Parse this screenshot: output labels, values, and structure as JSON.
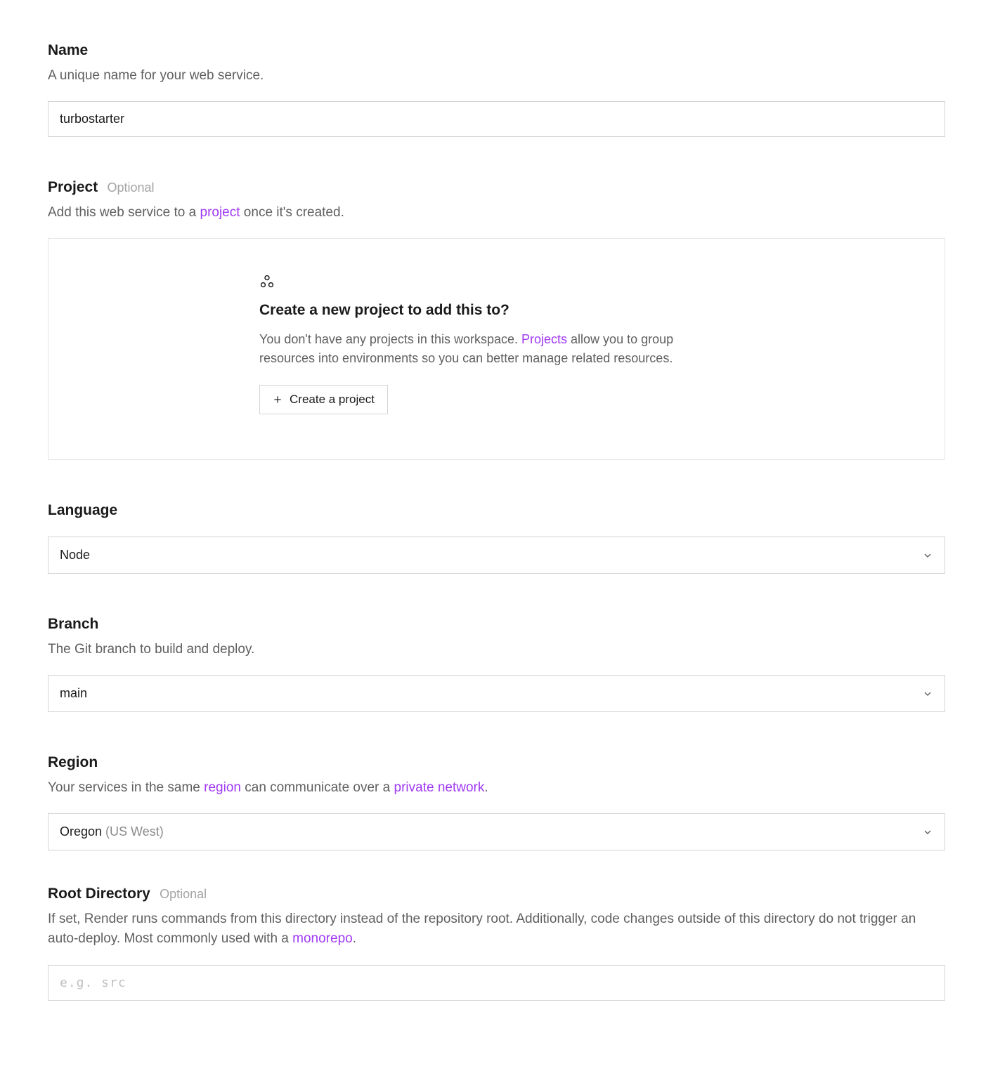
{
  "name": {
    "label": "Name",
    "description": "A unique name for your web service.",
    "value": "turbostarter"
  },
  "project": {
    "label": "Project",
    "optional": "Optional",
    "description_pre": "Add this web service to a ",
    "description_link": "project",
    "description_post": " once it's created.",
    "panel": {
      "title": "Create a new project to add this to?",
      "desc_pre": "You don't have any projects in this workspace. ",
      "desc_link": "Projects",
      "desc_post": " allow you to group resources into environments so you can better manage related resources.",
      "button": "Create a project"
    }
  },
  "language": {
    "label": "Language",
    "value": "Node"
  },
  "branch": {
    "label": "Branch",
    "description": "The Git branch to build and deploy.",
    "value": "main"
  },
  "region": {
    "label": "Region",
    "description_pre": "Your services in the same ",
    "description_link1": "region",
    "description_mid": " can communicate over a ",
    "description_link2": "private network",
    "description_post": ".",
    "value_main": "Oregon",
    "value_sub": " (US West)"
  },
  "root": {
    "label": "Root Directory",
    "optional": "Optional",
    "description_pre": "If set, Render runs commands from this directory instead of the repository root. Additionally, code changes outside of this directory do not trigger an auto-deploy. Most commonly used with a ",
    "description_link": "monorepo",
    "description_post": ".",
    "placeholder": "e.g. src"
  }
}
